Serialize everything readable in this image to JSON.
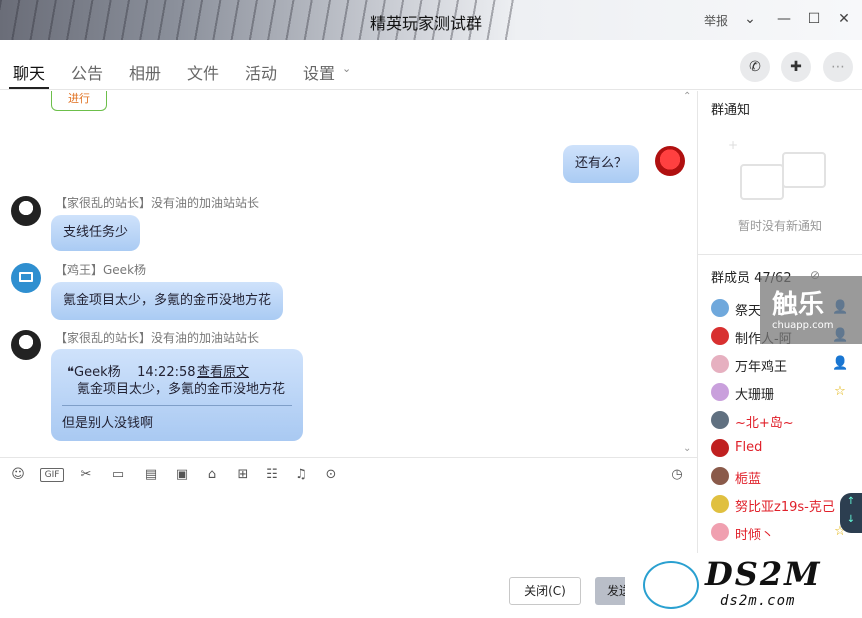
{
  "window": {
    "title": "精英玩家测试群",
    "report": "举报"
  },
  "tabs": [
    "聊天",
    "公告",
    "相册",
    "文件",
    "活动",
    "设置"
  ],
  "messages": {
    "top_partial": "进行",
    "self_msg": "还有么？",
    "m1_sender": "【家很乱的站长】没有油的加油站站长",
    "m1_text": "支线任务少",
    "m2_sender": "【鸡王】Geek杨",
    "m2_text": "氪金项目太少，多氪的金币没地方花",
    "m3_sender": "【家很乱的站长】没有油的加油站站长",
    "m3_quote_head": "❝Geek杨    14:22:58",
    "m3_quote_link": "查看原文",
    "m3_quote_text": "氪金项目太少，多氪的金币没地方花",
    "m3_reply": "但是别人没钱啊"
  },
  "toolbar": {
    "icons": [
      "smile-icon",
      "gif-icon",
      "scissors-icon",
      "folder-icon",
      "doc-icon",
      "image-icon",
      "shop-icon",
      "gift-icon",
      "vote-icon",
      "bell-icon",
      "more-icon",
      "clock-icon"
    ],
    "gif_label": "GIF"
  },
  "buttons": {
    "close": "关闭(C)",
    "send": "发送"
  },
  "notice": {
    "title": "群通知",
    "empty": "暂时没有新通知"
  },
  "members": {
    "title": "群成员 47/62",
    "list": [
      {
        "name": "祭天",
        "color": "#222222"
      },
      {
        "name": "制作人-阿",
        "color": "#222222"
      },
      {
        "name": "万年鸡王",
        "color": "#222222"
      },
      {
        "name": "大珊珊",
        "color": "#222222"
      },
      {
        "name": "~北+岛~",
        "color": "#e0202a"
      },
      {
        "name": "Fled",
        "color": "#e0202a"
      },
      {
        "name": "栀蓝",
        "color": "#e0202a"
      },
      {
        "name": "努比亚z19s-克己",
        "color": "#e0202a"
      },
      {
        "name": "时倾丶",
        "color": "#e0202a"
      }
    ]
  },
  "watermarks": {
    "chuapp": "触乐",
    "chuapp_url": "chuapp.com",
    "ds2m": "DS2M",
    "ds2m_url": "ds2m.com"
  }
}
